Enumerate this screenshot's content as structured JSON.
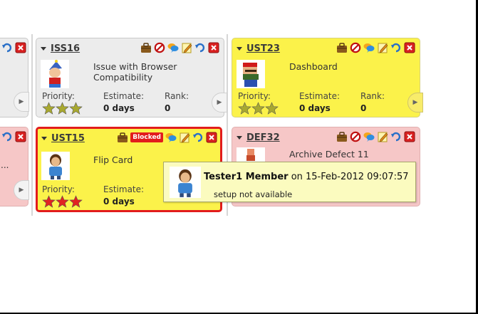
{
  "cards": [
    {
      "id": "ISS16",
      "title": "Issue with Browser Compatibility",
      "priority_label": "Priority:",
      "estimate_label": "Estimate:",
      "estimate_value": "0 days",
      "rank_label": "Rank:",
      "rank_value": "0",
      "priority_stars": 3,
      "star_color": "#a8a830"
    },
    {
      "id": "UST23",
      "title": "Dashboard",
      "priority_label": "Priority:",
      "estimate_label": "Estimate:",
      "estimate_value": "0 days",
      "rank_label": "Rank:",
      "rank_value": "0",
      "priority_stars": 3,
      "star_color": "#a8a830"
    },
    {
      "id": "UST15",
      "title": "Flip Card",
      "blocked_label": "Blocked",
      "priority_label": "Priority:",
      "estimate_label": "Estimate:",
      "estimate_value": "0 days",
      "priority_stars": 3,
      "star_color": "#e12222"
    },
    {
      "id": "DEF32",
      "title": "Archive Defect 11"
    }
  ],
  "left_partial": {
    "ellipsis": "..."
  },
  "tooltip": {
    "author": "Tester1 Member",
    "on_text": "on 15-Feb-2012 09:07:57",
    "message": "setup not available"
  },
  "colors": {
    "gray_card": "#ececec",
    "yellow_card": "#fbf24a",
    "pink_card": "#f6c7c7",
    "blocked_border": "#e21c1c",
    "tooltip_bg": "#fbfbbf"
  }
}
